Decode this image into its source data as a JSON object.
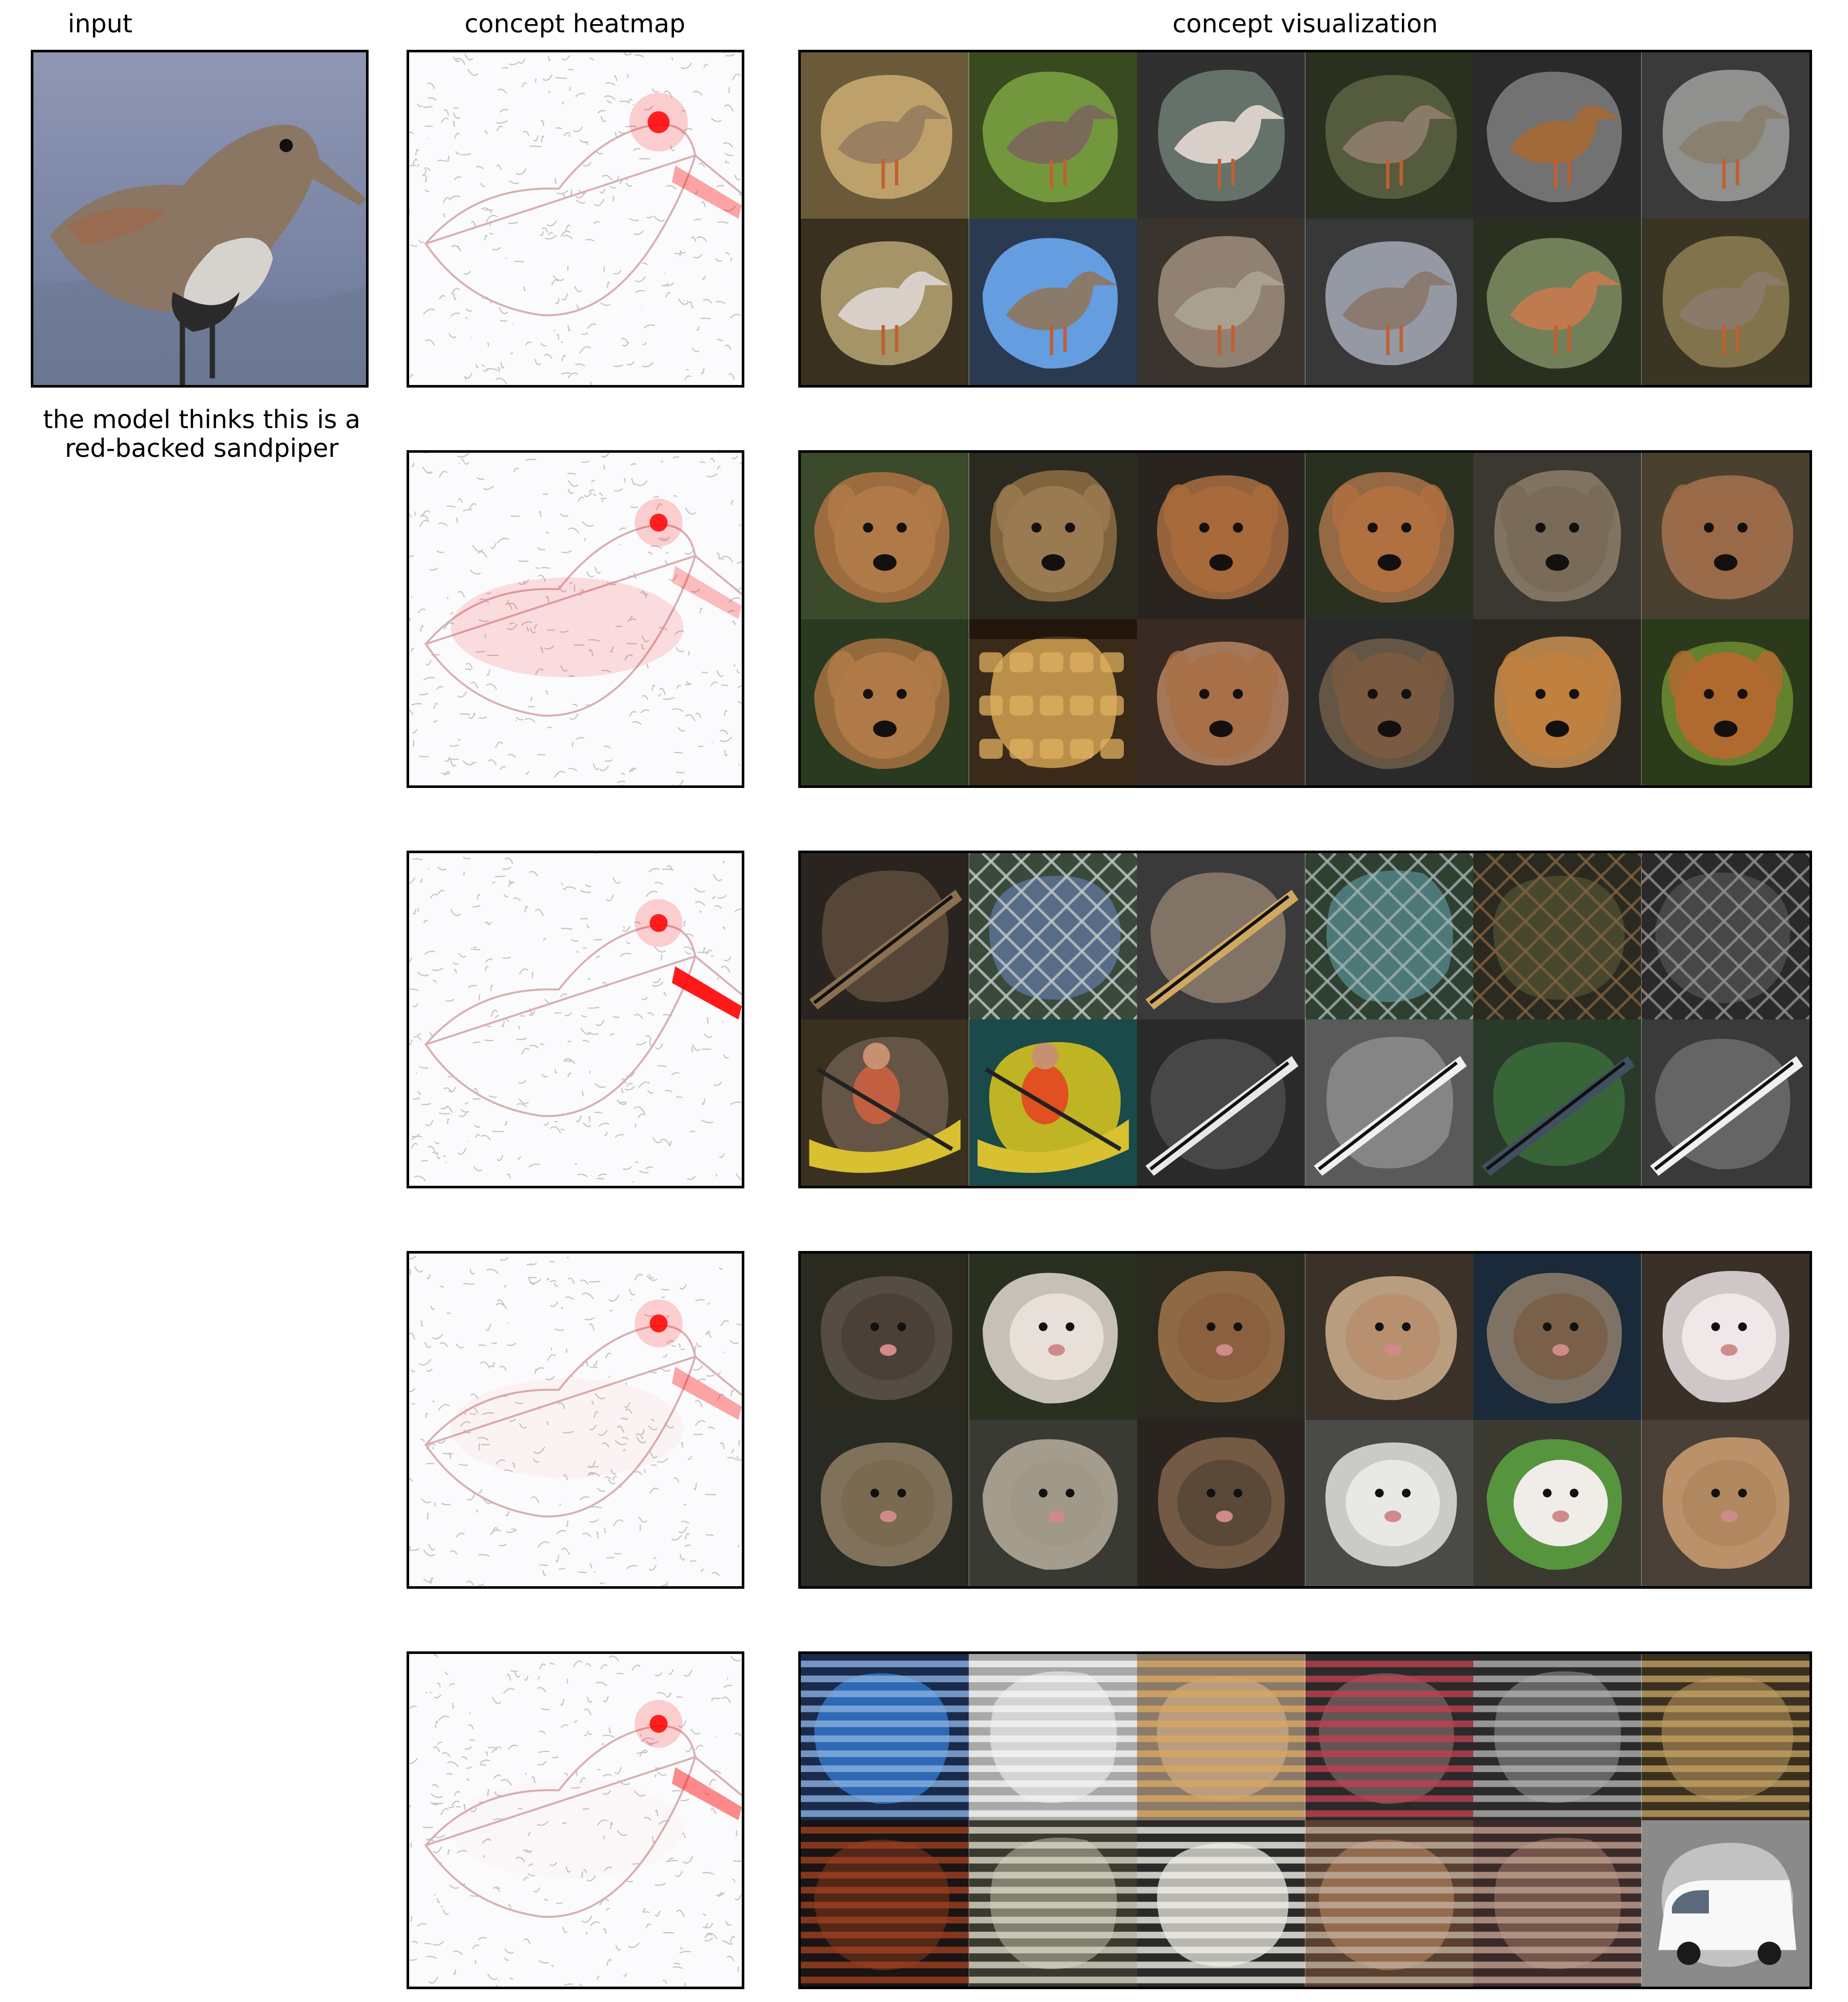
{
  "headers": {
    "input": "input",
    "heatmap": "concept heatmap",
    "visualization": "concept visualization"
  },
  "prediction": {
    "line1": "the model thinks this is a",
    "line2": "red-backed sandpiper"
  },
  "input_image": {
    "subject": "sandpiper-bird",
    "colors": {
      "background": "#7d86a6",
      "bird": "#8a7a68",
      "belly": "#d8d6d2"
    }
  },
  "colors": {
    "heat_red": "#ff0000",
    "edge_gray": "#b8b8b8",
    "frame": "#000000"
  },
  "concepts": [
    {
      "name": "concept-1",
      "tiles": [
        {
          "kind": "bird",
          "bg": "#6a5a3a",
          "mask": "#c8a870",
          "subject": "#9a8060"
        },
        {
          "kind": "bird",
          "bg": "#3a4a20",
          "mask": "#7aa040",
          "subject": "#7a6a5a"
        },
        {
          "kind": "bird",
          "bg": "#303030",
          "mask": "#6a7a70",
          "subject": "#d8d0c8"
        },
        {
          "kind": "bird",
          "bg": "#2a3020",
          "mask": "#5a6040",
          "subject": "#8a7a6a"
        },
        {
          "kind": "bird",
          "bg": "#2a2a2a",
          "mask": "#7a7a7a",
          "subject": "#a06a3a"
        },
        {
          "kind": "bird",
          "bg": "#3a3a3a",
          "mask": "#9a9a98",
          "subject": "#8a8070"
        },
        {
          "kind": "bird",
          "bg": "#3a3020",
          "mask": "#b0a070",
          "subject": "#d8d0c8"
        },
        {
          "kind": "bird",
          "bg": "#2a3a50",
          "mask": "#6aa8f0",
          "subject": "#8a7a6a"
        },
        {
          "kind": "bird",
          "bg": "#3a342e",
          "mask": "#9a8a7a",
          "subject": "#aaa090"
        },
        {
          "kind": "bird",
          "bg": "#383838",
          "mask": "#a0a4b0",
          "subject": "#8a7a70"
        },
        {
          "kind": "bird",
          "bg": "#2a3020",
          "mask": "#7a8a60",
          "subject": "#c07a50"
        },
        {
          "kind": "bird",
          "bg": "#3a3424",
          "mask": "#8a7a50",
          "subject": "#8a7a6a"
        }
      ]
    },
    {
      "name": "concept-2",
      "tiles": [
        {
          "kind": "dog",
          "bg": "#3a4a2a",
          "mask": "#a87040",
          "subject": "#b07a48"
        },
        {
          "kind": "dog",
          "bg": "#2a2a20",
          "mask": "#8a6a40",
          "subject": "#9a7a50"
        },
        {
          "kind": "dog",
          "bg": "#2a2420",
          "mask": "#a06a40",
          "subject": "#a86a3a"
        },
        {
          "kind": "dog",
          "bg": "#2a3020",
          "mask": "#a07048",
          "subject": "#b07040"
        },
        {
          "kind": "dog",
          "bg": "#3a3830",
          "mask": "#8a7a68",
          "subject": "#7a6a58"
        },
        {
          "kind": "dog",
          "bg": "#4a4030",
          "mask": "#a07050",
          "subject": "#9a6a48"
        },
        {
          "kind": "dog",
          "bg": "#2a3a20",
          "mask": "#a07040",
          "subject": "#b07a48"
        },
        {
          "kind": "shop",
          "bg": "#3a2a1a",
          "mask": "#c89a50",
          "subject": "#e0b060"
        },
        {
          "kind": "dog",
          "bg": "#3a2a24",
          "mask": "#b08060",
          "subject": "#a87048"
        },
        {
          "kind": "dog",
          "bg": "#2a2a2a",
          "mask": "#6a5a48",
          "subject": "#7a5a40"
        },
        {
          "kind": "dog",
          "bg": "#2a2820",
          "mask": "#c08a50",
          "subject": "#c08040"
        },
        {
          "kind": "dog",
          "bg": "#2a3a1a",
          "mask": "#6a8a30",
          "subject": "#b06a30"
        }
      ]
    },
    {
      "name": "concept-3",
      "tiles": [
        {
          "kind": "stick",
          "bg": "#2a2420",
          "mask": "#5a4a3a",
          "subject": "#8a7050"
        },
        {
          "kind": "fence",
          "bg": "#3a4a3a",
          "mask": "#5a7090",
          "subject": "#c0c8c8"
        },
        {
          "kind": "stick",
          "bg": "#3a3a3a",
          "mask": "#8a7a6a",
          "subject": "#d0a860"
        },
        {
          "kind": "fence",
          "bg": "#304030",
          "mask": "#508080",
          "subject": "#a0b0b0"
        },
        {
          "kind": "fence",
          "bg": "#2a2a20",
          "mask": "#4a4a30",
          "subject": "#806040"
        },
        {
          "kind": "fence",
          "bg": "#2a2a2a",
          "mask": "#4a4a4a",
          "subject": "#909090"
        },
        {
          "kind": "boat",
          "bg": "#3a3020",
          "mask": "#6a5a4a",
          "subject": "#c06040"
        },
        {
          "kind": "boat",
          "bg": "#1a4a4a",
          "mask": "#d0c020",
          "subject": "#e05020"
        },
        {
          "kind": "stick",
          "bg": "#2a2a2a",
          "mask": "#4a4a4a",
          "subject": "#e8e8e8"
        },
        {
          "kind": "stick",
          "bg": "#5a5a5a",
          "mask": "#8a8a8a",
          "subject": "#f0f0f0"
        },
        {
          "kind": "stick",
          "bg": "#2a3a2a",
          "mask": "#3a6a3a",
          "subject": "#405060"
        },
        {
          "kind": "stick",
          "bg": "#3a3a3a",
          "mask": "#6a6a6a",
          "subject": "#f0f0f0"
        }
      ]
    },
    {
      "name": "concept-4",
      "tiles": [
        {
          "kind": "animal",
          "bg": "#2a2a20",
          "mask": "#5a5048",
          "subject": "#4a4038"
        },
        {
          "kind": "animal",
          "bg": "#2a3020",
          "mask": "#d8d0c8",
          "subject": "#e8e0d8"
        },
        {
          "kind": "animal",
          "bg": "#2a2a20",
          "mask": "#9a7048",
          "subject": "#8a6040"
        },
        {
          "kind": "animal",
          "bg": "#3a3228",
          "mask": "#c8a888",
          "subject": "#b89070"
        },
        {
          "kind": "animal",
          "bg": "#1a2a3a",
          "mask": "#8a7a6a",
          "subject": "#7a6048"
        },
        {
          "kind": "animal",
          "bg": "#3a3028",
          "mask": "#e0d8d8",
          "subject": "#f0e8e8"
        },
        {
          "kind": "animal",
          "bg": "#2a2a24",
          "mask": "#8a7a60",
          "subject": "#7a6a50"
        },
        {
          "kind": "animal",
          "bg": "#3a3a34",
          "mask": "#b0a898",
          "subject": "#a09888"
        },
        {
          "kind": "animal",
          "bg": "#2a2420",
          "mask": "#7a6048",
          "subject": "#5a4838"
        },
        {
          "kind": "animal",
          "bg": "#4a4a48",
          "mask": "#d8d8d4",
          "subject": "#e8e8e4"
        },
        {
          "kind": "animal",
          "bg": "#3a3a30",
          "mask": "#5aa040",
          "subject": "#f0ece8"
        },
        {
          "kind": "animal",
          "bg": "#4a4038",
          "mask": "#c89a70",
          "subject": "#b08860"
        }
      ]
    },
    {
      "name": "concept-5",
      "tiles": [
        {
          "kind": "stripes",
          "bg": "#1a2a4a",
          "mask": "#3070c0",
          "subject": "#8ab0e0"
        },
        {
          "kind": "stripes",
          "bg": "#a8a8a8",
          "mask": "#d8d8d8",
          "subject": "#f4f4f4"
        },
        {
          "kind": "stripes",
          "bg": "#8a7a6a",
          "mask": "#c0a080",
          "subject": "#d8a860"
        },
        {
          "kind": "stripes",
          "bg": "#2a2a2a",
          "mask": "#6a5a5a",
          "subject": "#c04050"
        },
        {
          "kind": "stripes",
          "bg": "#2a2a2a",
          "mask": "#6a6a6a",
          "subject": "#b0b0b0"
        },
        {
          "kind": "stripes",
          "bg": "#3a3020",
          "mask": "#8a7048",
          "subject": "#c0a060"
        },
        {
          "kind": "stripes",
          "bg": "#1a1414",
          "mask": "#5a2a1a",
          "subject": "#a04020"
        },
        {
          "kind": "stripes",
          "bg": "#3a3a30",
          "mask": "#8a8a78",
          "subject": "#d8d8c8"
        },
        {
          "kind": "stripes",
          "bg": "#2a2a2a",
          "mask": "#c8c8c0",
          "subject": "#f0f0e8"
        },
        {
          "kind": "stripes",
          "bg": "#5a4030",
          "mask": "#9a7050",
          "subject": "#c0b0a0"
        },
        {
          "kind": "stripes",
          "bg": "#3a2a2a",
          "mask": "#7a5a50",
          "subject": "#c0a090"
        },
        {
          "kind": "van",
          "bg": "#8a8a8a",
          "mask": "#c8c8c8",
          "subject": "#f8f8f8"
        }
      ]
    }
  ]
}
